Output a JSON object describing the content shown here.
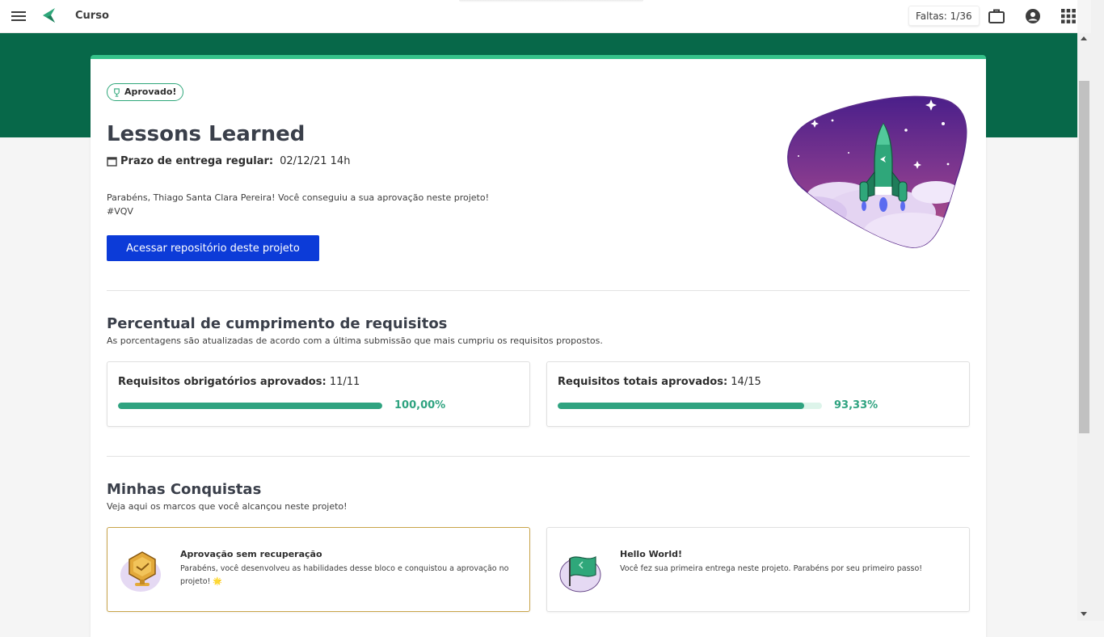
{
  "topbar": {
    "course": "Curso",
    "faltas": "Faltas: 1/36",
    "icons": [
      "menu-icon",
      "logo-icon",
      "briefcase-icon",
      "account-icon",
      "apps-grid-icon"
    ]
  },
  "project": {
    "badge": "Aprovado!",
    "title": "Lessons Learned",
    "deadline_label": "Prazo de entrega regular:",
    "deadline_value": "02/12/21 14h",
    "message_line1": "Parabéns, Thiago Santa Clara Pereira! Você conseguiu a sua aprovação neste projeto!",
    "message_line2": "#VQV",
    "repo_button": "Acessar repositório deste projeto"
  },
  "requirements": {
    "title": "Percentual de cumprimento de requisitos",
    "subtitle": "As porcentagens são atualizadas de acordo com a última submissão que mais cumpriu os requisitos propostos.",
    "cards": [
      {
        "label": "Requisitos obrigatórios aprovados:",
        "value": "11/11",
        "percent_text": "100,00%",
        "progress": 1.0
      },
      {
        "label": "Requisitos totais aprovados:",
        "value": "14/15",
        "percent_text": "93,33%",
        "progress": 0.9333
      }
    ]
  },
  "achievements": {
    "title": "Minhas Conquistas",
    "subtitle": "Veja aqui os marcos que você alcançou neste projeto!",
    "items": [
      {
        "title": "Aprovação sem recuperação",
        "description": "Parabéns, você desenvolveu as habilidades desse bloco e conquistou a aprovação no projeto! 🌟",
        "icon": "medal-icon"
      },
      {
        "title": "Hello World!",
        "description": "Você fez sua primeira entrega neste projeto. Parabéns por seu primeiro passo!",
        "icon": "flag-icon"
      }
    ]
  },
  "colors": {
    "brand_green": "#076849",
    "accent_green": "#35c28a",
    "progress": "#2fa380",
    "button_blue": "#0c3bd8"
  }
}
